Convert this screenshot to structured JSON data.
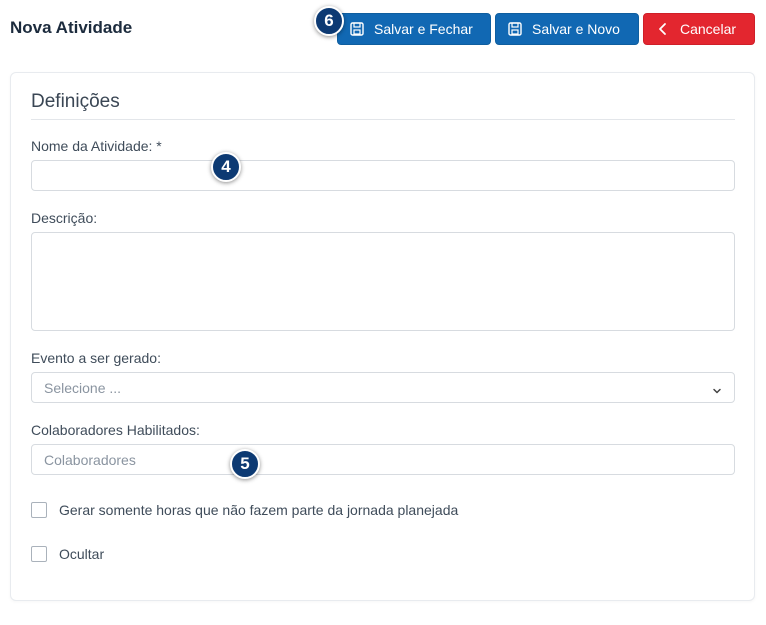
{
  "header": {
    "title": "Nova Atividade",
    "save_close_label": "Salvar e Fechar",
    "save_new_label": "Salvar e Novo",
    "cancel_label": "Cancelar"
  },
  "form": {
    "section_title": "Definições",
    "name_label": "Nome da Atividade: *",
    "name_value": "",
    "description_label": "Descrição:",
    "description_value": "",
    "event_label": "Evento a ser gerado:",
    "event_placeholder": "Selecione ...",
    "collaborators_label": "Colaboradores Habilitados:",
    "collaborators_placeholder": "Colaboradores",
    "checkbox_hours_label": "Gerar somente horas que não fazem parte da jornada planejada",
    "checkbox_hours_checked": false,
    "checkbox_hide_label": "Ocultar",
    "checkbox_hide_checked": false
  },
  "markers": {
    "save_close": "6",
    "name_field": "4",
    "collaborators_field": "5"
  },
  "colors": {
    "primary": "#1168b3",
    "danger": "#e3262f",
    "marker": "#0d3a73"
  },
  "icons": {
    "save": "floppy-disk-icon",
    "cancel": "chevron-left-icon",
    "select": "chevron-down-icon"
  }
}
